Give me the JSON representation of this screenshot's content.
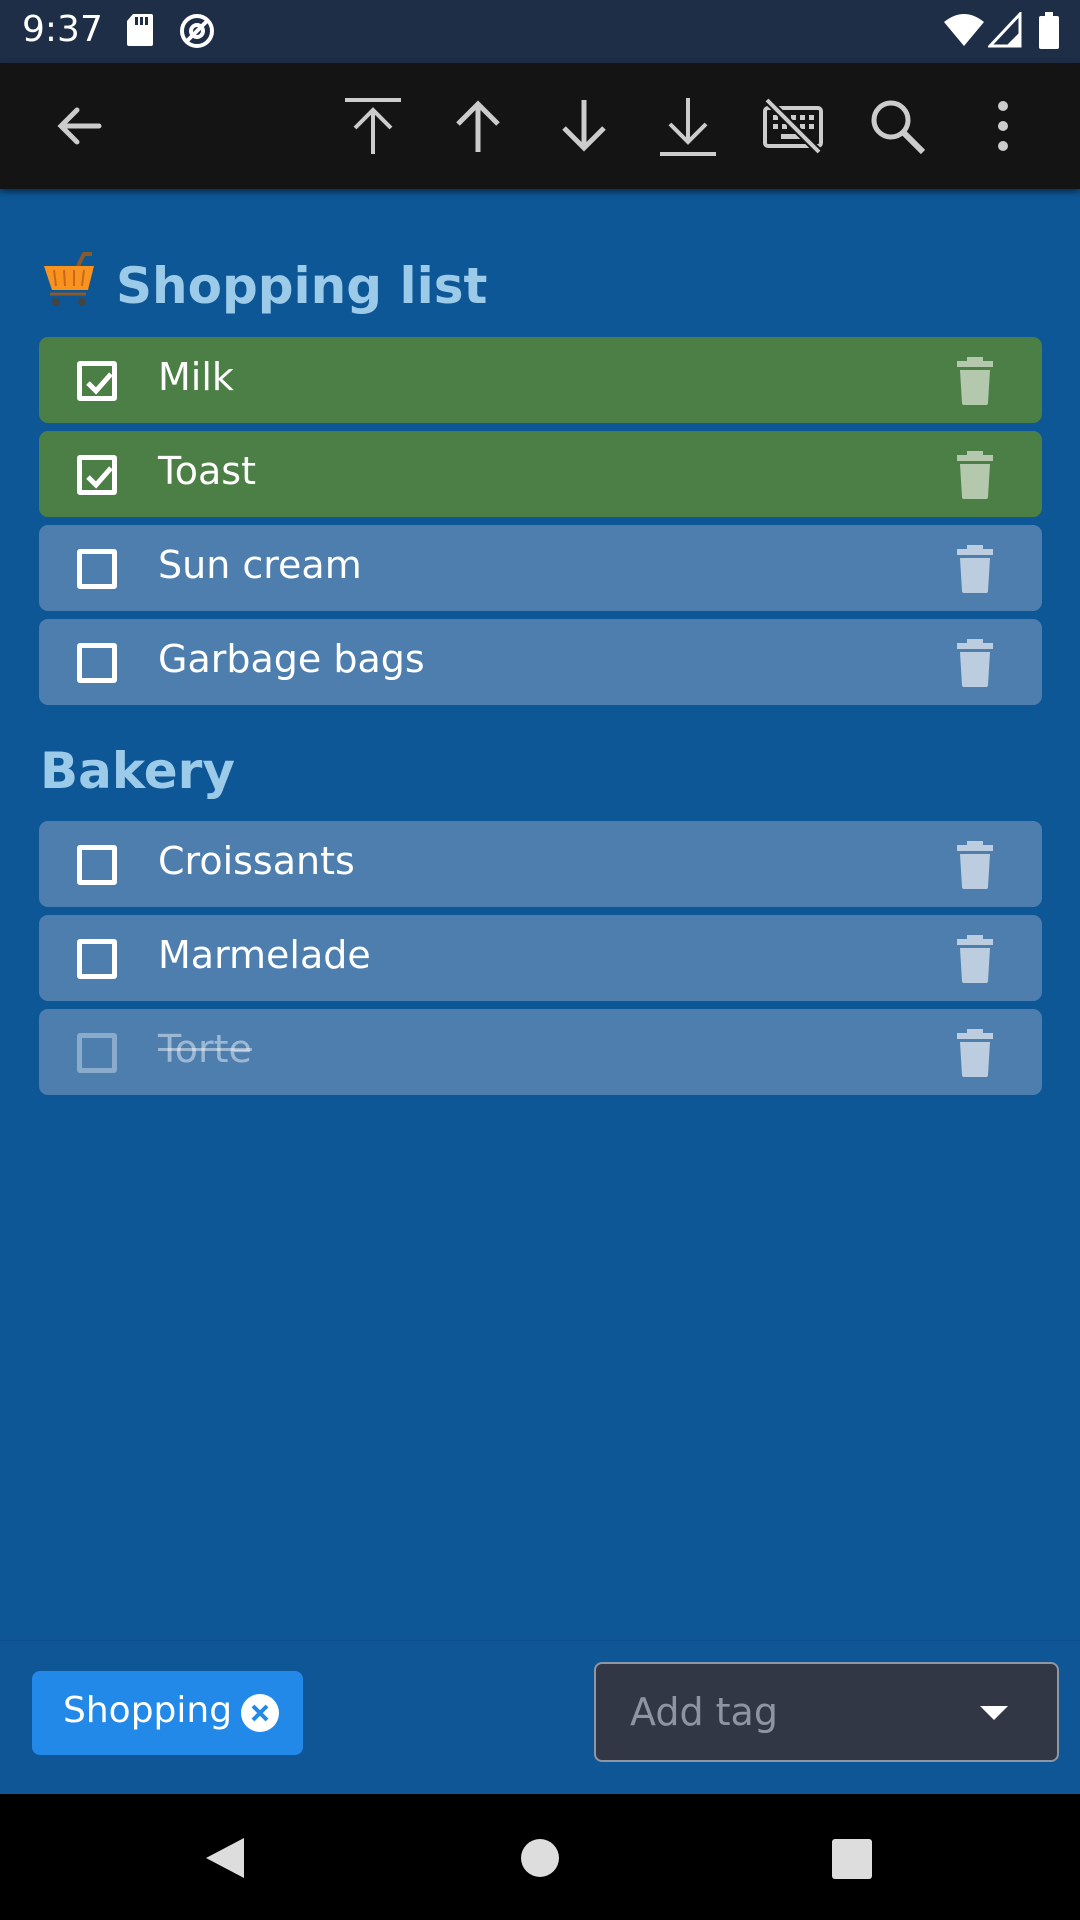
{
  "status_bar": {
    "time": "9:37",
    "icons": [
      "sd-card-icon",
      "vpn-icon",
      "wifi-icon",
      "signal-icon",
      "battery-icon"
    ]
  },
  "toolbar": {
    "icons": [
      "back-arrow-icon",
      "move-to-top-icon",
      "move-up-icon",
      "move-down-icon",
      "move-to-bottom-icon",
      "keyboard-off-icon",
      "search-icon",
      "more-vert-icon"
    ]
  },
  "sections": [
    {
      "title": "Shopping list",
      "icon": "shopping-cart-icon",
      "items": [
        {
          "label": "Milk",
          "checked": true
        },
        {
          "label": "Toast",
          "checked": true
        },
        {
          "label": "Sun cream",
          "checked": false
        },
        {
          "label": "Garbage bags",
          "checked": false
        }
      ]
    },
    {
      "title": "Bakery",
      "items": [
        {
          "label": "Croissants",
          "checked": false
        },
        {
          "label": "Marmelade",
          "checked": false
        },
        {
          "label": "Torte",
          "checked": false,
          "struck_through": true
        }
      ]
    }
  ],
  "tags": {
    "chip_label": "Shopping",
    "add_tag_placeholder": "Add tag"
  },
  "nav_bar": {
    "icons": [
      "nav-back-icon",
      "nav-home-icon",
      "nav-recents-icon"
    ]
  },
  "colors": {
    "background": "#0e5797",
    "item_unchecked": "#4d7eae",
    "item_checked": "#4b7f45",
    "section_title": "#9ccbe9",
    "chip": "#2389e8",
    "toolbar": "#141414",
    "status_bar": "#1e2e47"
  }
}
